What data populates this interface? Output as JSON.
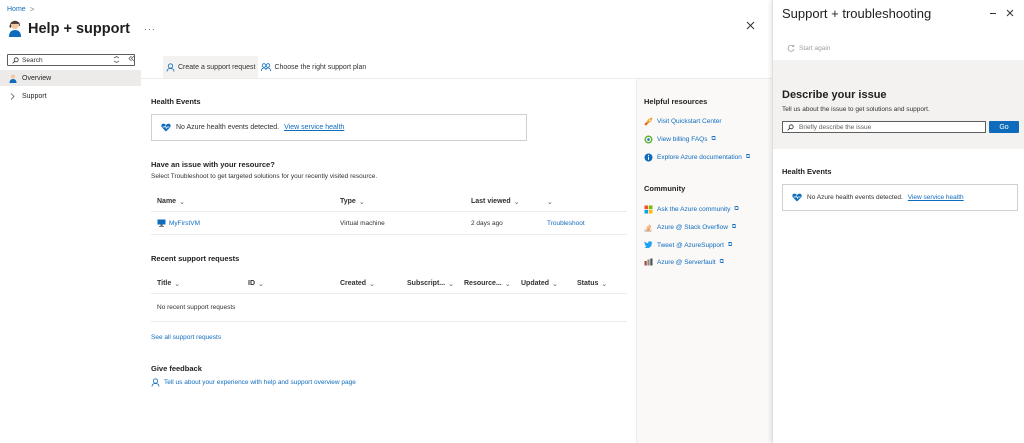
{
  "breadcrumb": {
    "home": "Home",
    "separator": ">"
  },
  "header": {
    "title": "Help + support",
    "more": "···"
  },
  "sidebar": {
    "search_placeholder": "Search",
    "items": [
      {
        "label": "Overview",
        "selected": true
      },
      {
        "label": "Support",
        "selected": false
      }
    ]
  },
  "command_bar": {
    "create_request": "Create a support request",
    "choose_plan": "Choose the right support plan"
  },
  "health_events": {
    "title": "Health Events",
    "message": "No Azure health events detected.",
    "link": "View service health"
  },
  "issue": {
    "title": "Have an issue with your resource?",
    "description": "Select Troubleshoot to get targeted solutions for your recently visited resource.",
    "columns": [
      "Name",
      "Type",
      "Last viewed",
      ""
    ],
    "rows": [
      {
        "name": "MyFirstVM",
        "type": "Virtual machine",
        "last_viewed": "2 days ago",
        "action": "Troubleshoot"
      }
    ]
  },
  "recent_requests": {
    "title": "Recent support requests",
    "columns": [
      "Title",
      "ID",
      "Created",
      "Subscript...",
      "Resource...",
      "Updated",
      "Status"
    ],
    "empty": "No recent support requests",
    "see_all": "See all support requests"
  },
  "feedback": {
    "title": "Give feedback",
    "link": "Tell us about your experience with help and support overview page"
  },
  "helpful_resources": {
    "title": "Helpful resources",
    "items": [
      "Visit Quickstart Center",
      "View billing FAQs",
      "Explore Azure documentation"
    ]
  },
  "community": {
    "title": "Community",
    "items": [
      "Ask the Azure community",
      "Azure @ Stack Overflow",
      "Tweet @ AzureSupport",
      "Azure @ Serverfault"
    ]
  },
  "blade": {
    "title": "Support + troubleshooting",
    "start_again": "Start again",
    "describe_title": "Describe your issue",
    "describe_desc": "Tell us about the issue to get solutions and support.",
    "search_placeholder": "Briefly describe the issue",
    "go": "Go",
    "health_title": "Health Events",
    "health_message": "No Azure health events detected.",
    "health_link": "View service health"
  },
  "colors": {
    "accent": "#0f6cbd",
    "heart": "#0f6cbd",
    "text": "#323130"
  }
}
